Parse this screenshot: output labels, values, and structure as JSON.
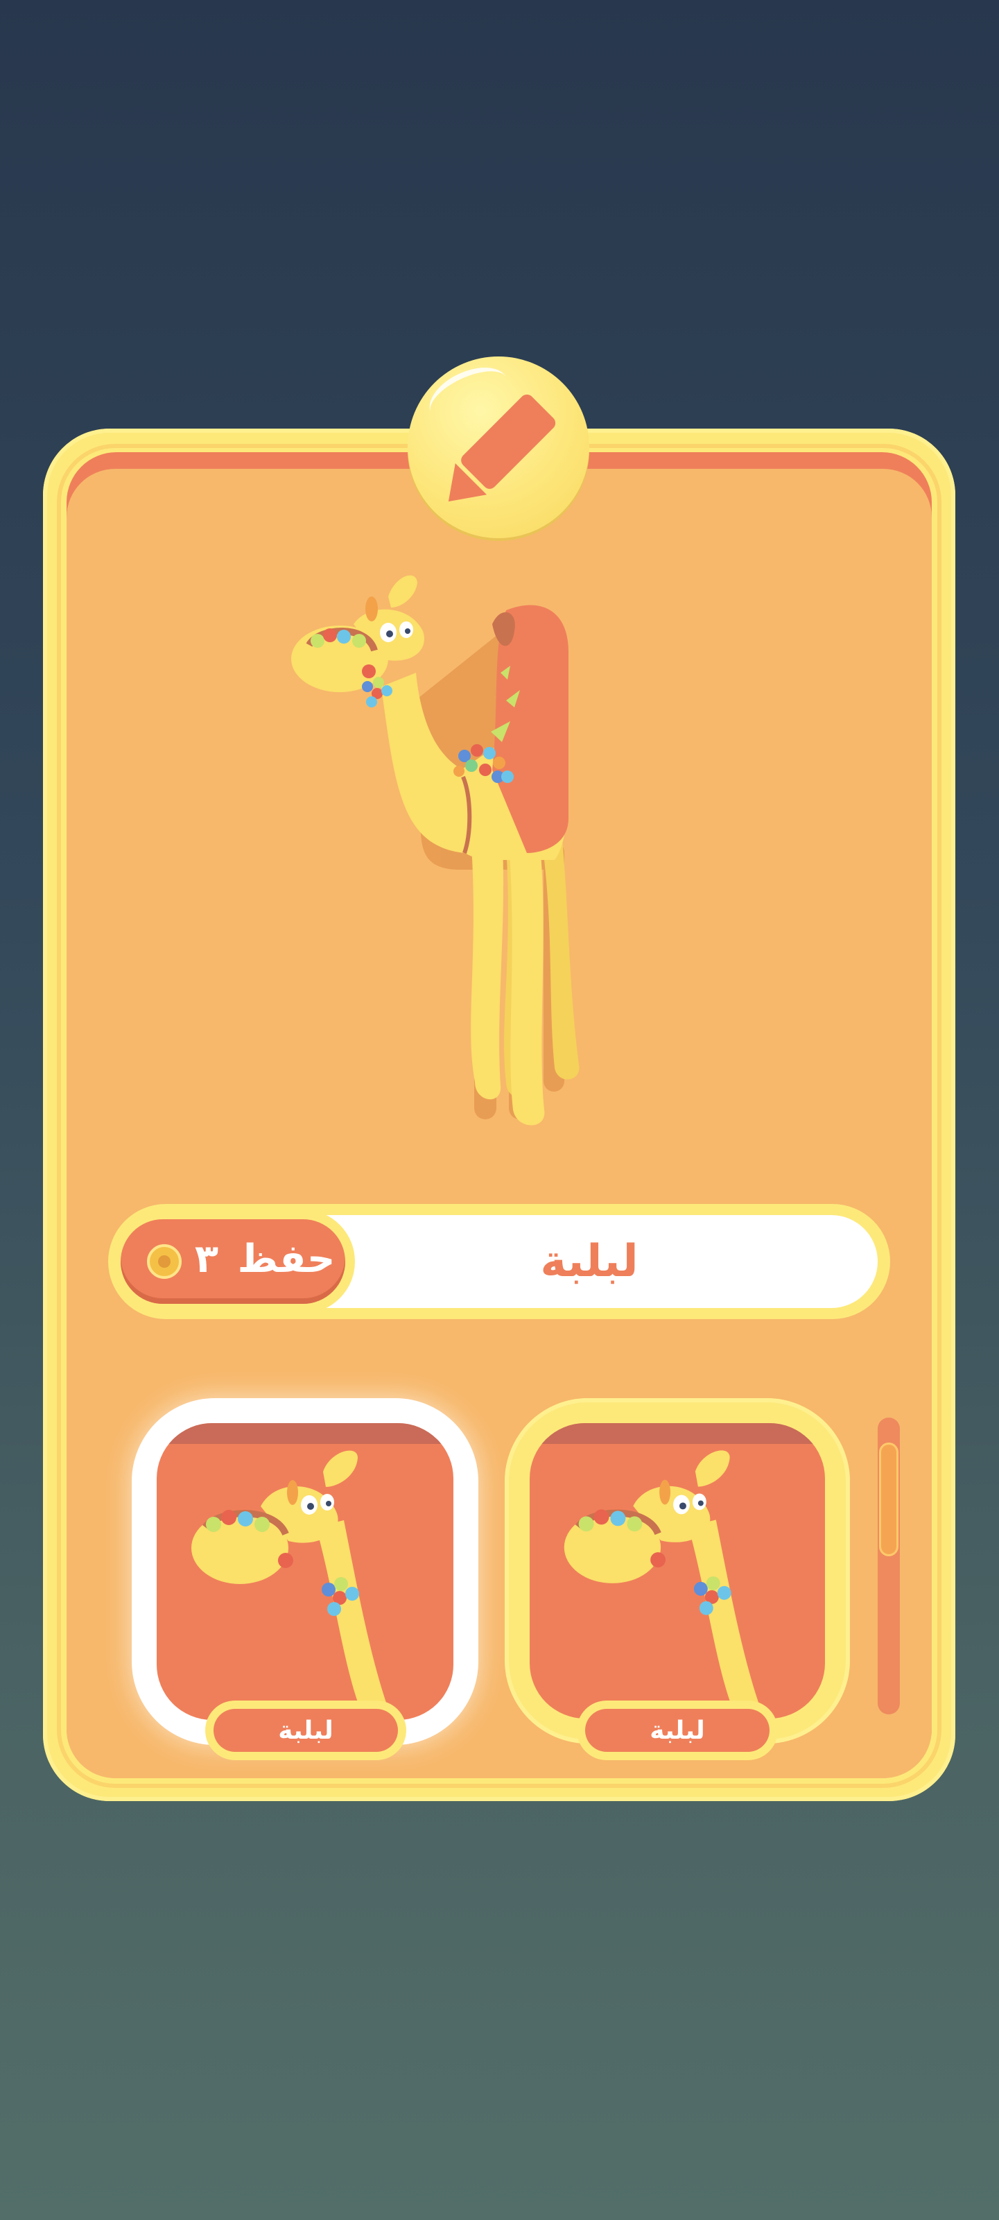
{
  "edit_button": {
    "icon": "pencil-icon"
  },
  "hero": {
    "image": "camel-character"
  },
  "name_bar": {
    "name": "لبلبة"
  },
  "save_button": {
    "label": "حفظ",
    "cost": "٣",
    "currency_icon": "coin-icon"
  },
  "outfits": [
    {
      "label": "لبلبة",
      "selected": true
    },
    {
      "label": "لبلبة",
      "selected": false
    }
  ],
  "colors": {
    "card_frame": "#fde97a",
    "card_fill": "#f7b86b",
    "accent": "#ef7f5a",
    "camel": "#fbe06a",
    "name_text": "#ee7f5a"
  }
}
